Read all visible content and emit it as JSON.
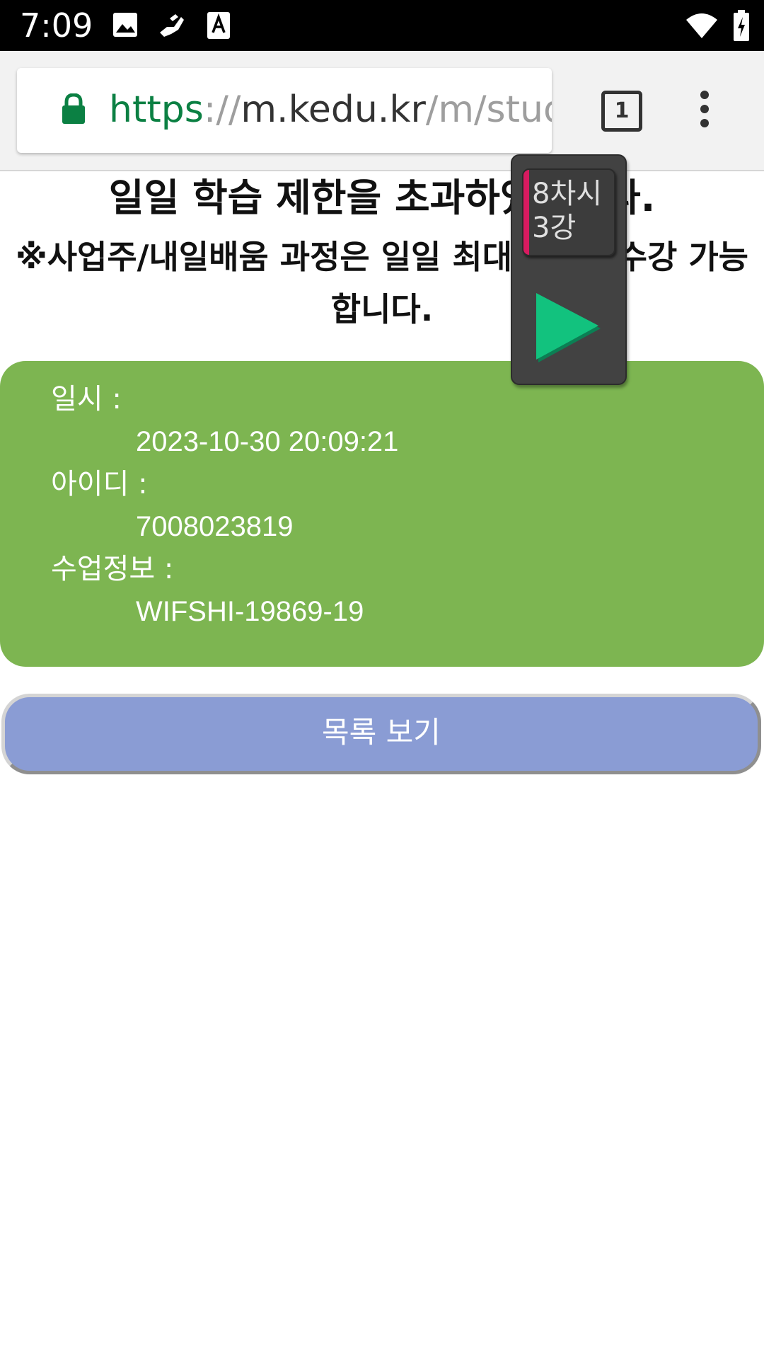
{
  "status_bar": {
    "time": "7:09",
    "icons": [
      "image-icon",
      "hand-icon",
      "font-icon",
      "wifi-icon",
      "battery-icon"
    ]
  },
  "browser": {
    "url_scheme": "https",
    "url_separator": "://",
    "url_host": "m.kedu.kr",
    "url_path": "/m/study",
    "tab_count": "1",
    "secure_color": "#0b8043"
  },
  "page": {
    "heading": "일일 학습 제한을 초과하였습니다.",
    "notice_line1": "※사업주/내일배움 과정은 일일 최대 8차시 수강 가능",
    "notice_line2": "합니다.",
    "info": {
      "date_label": "일시 :",
      "date_value": "2023-10-30 20:09:21",
      "id_label": "아이디 :",
      "id_value": "7008023819",
      "class_label": "수업정보 :",
      "class_value": "WIFSHI-19869-19"
    },
    "list_button_label": "목록 보기",
    "card_color": "#7db551",
    "button_color": "#8a9cd4"
  },
  "floating_player": {
    "lesson_line1": "8차시",
    "lesson_line2": "3강",
    "accent_color": "#d81b60",
    "play_color": "#12c27e",
    "icon": "play-icon"
  }
}
